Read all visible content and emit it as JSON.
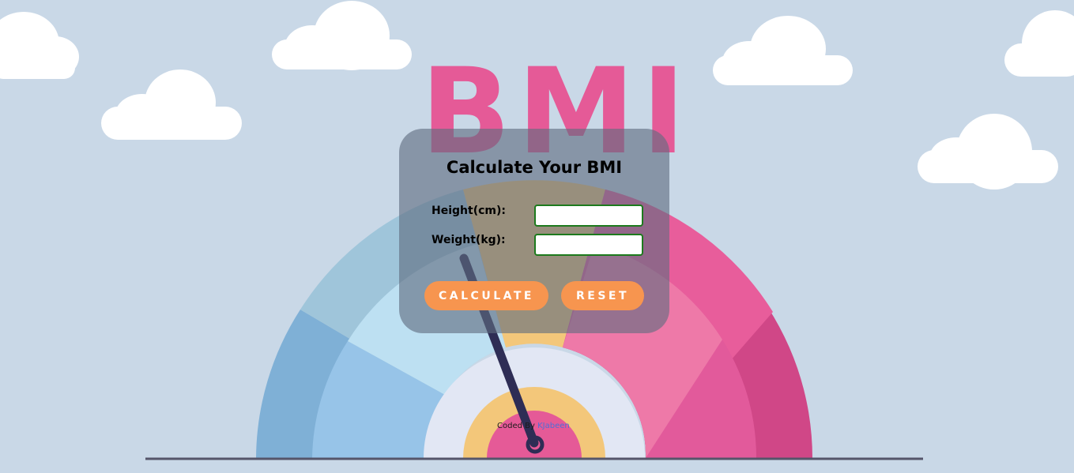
{
  "background": {
    "sky_color": "#c9d8e7",
    "cloud_color": "#ffffff",
    "bmi_word": "BMI",
    "bmi_word_color": "#e55a97",
    "gauge_colors": {
      "underweight_outer": "#7fb0d6",
      "underweight_inner": "#97c4e8",
      "normal_outer": "#9fc5da",
      "normal_inner": "#bde0f2",
      "overweight": "#f3c77a",
      "obese_inner": "#ee79a8",
      "obese_mid": "#e25a9b",
      "obese_outer": "#d04787",
      "hub": "#e2e7f4",
      "needle": "#2e2d55",
      "ground_line": "#55556a"
    }
  },
  "form": {
    "title": "Calculate Your BMI",
    "height_label": "Height(cm):",
    "height_value": "",
    "weight_label": "Weight(kg):",
    "weight_value": "",
    "calculate_label": "CALCULATE",
    "reset_label": "RESET",
    "button_color": "#f7954f",
    "input_border_color": "#1d7a1d"
  },
  "footer": {
    "credit_prefix": "Coded By",
    "author": "KJabeen"
  }
}
